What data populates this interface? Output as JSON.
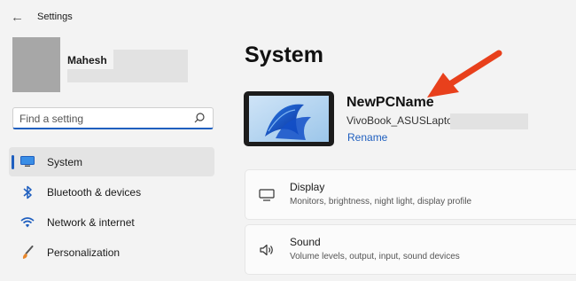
{
  "app": {
    "title": "Settings",
    "back_icon": "back-arrow-icon"
  },
  "account": {
    "name": "Mahesh"
  },
  "search": {
    "placeholder": "Find a setting",
    "value": ""
  },
  "sidebar": {
    "items": [
      {
        "label": "System",
        "icon": "monitor-icon",
        "active": true
      },
      {
        "label": "Bluetooth & devices",
        "icon": "bluetooth-icon",
        "active": false
      },
      {
        "label": "Network & internet",
        "icon": "wifi-icon",
        "active": false
      },
      {
        "label": "Personalization",
        "icon": "brush-icon",
        "active": false
      }
    ]
  },
  "main": {
    "title": "System",
    "device": {
      "name": "NewPCName",
      "model": "VivoBook_ASUSLaptop",
      "rename_label": "Rename"
    },
    "cards": [
      {
        "title": "Display",
        "description": "Monitors, brightness, night light, display profile",
        "icon": "display-icon"
      },
      {
        "title": "Sound",
        "description": "Volume levels, output, input, sound devices",
        "icon": "speaker-icon"
      }
    ]
  },
  "colors": {
    "accent": "#1f5fbf",
    "annotation_arrow": "#e8401c",
    "background": "#f3f3f3"
  }
}
